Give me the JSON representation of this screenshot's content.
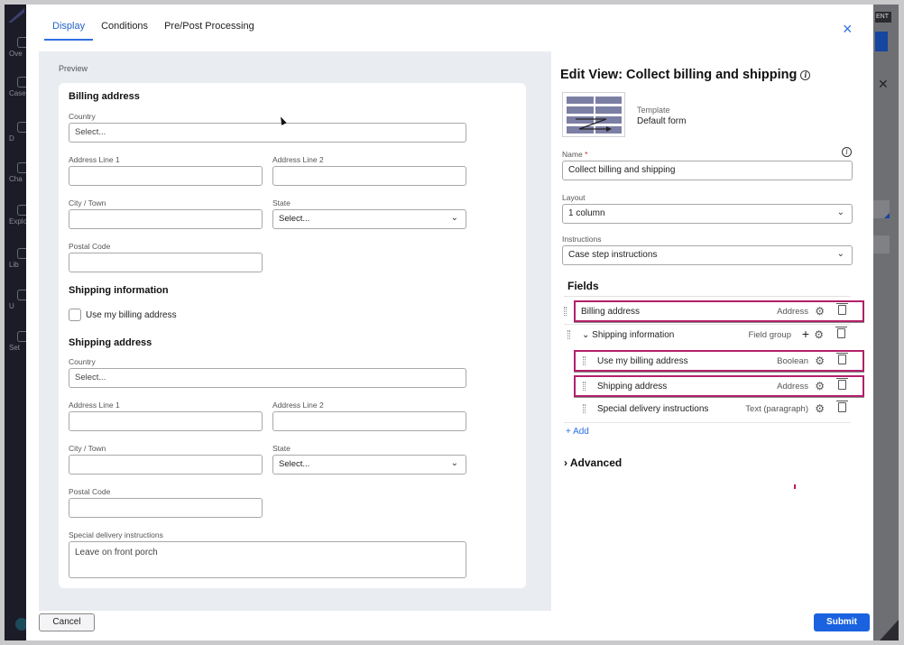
{
  "background_app": {
    "nav_items": [
      "Ove",
      "Case",
      "D",
      "Cha",
      "Explo",
      "Lib",
      "U",
      "Set"
    ],
    "env_badge": "ENT"
  },
  "modal": {
    "tabs": [
      {
        "label": "Display",
        "active": true
      },
      {
        "label": "Conditions",
        "active": false
      },
      {
        "label": "Pre/Post Processing",
        "active": false
      }
    ],
    "close_label": "×",
    "preview": {
      "label": "Preview",
      "billing": {
        "title": "Billing address",
        "country_label": "Country",
        "country_placeholder": "Select...",
        "addr1_label": "Address Line 1",
        "addr2_label": "Address Line 2",
        "city_label": "City / Town",
        "state_label": "State",
        "state_placeholder": "Select...",
        "postal_label": "Postal Code"
      },
      "shipping_info": {
        "title": "Shipping information",
        "checkbox_label": "Use my billing address",
        "checked": false
      },
      "shipping": {
        "title": "Shipping address",
        "country_label": "Country",
        "country_placeholder": "Select...",
        "addr1_label": "Address Line 1",
        "addr2_label": "Address Line 2",
        "city_label": "City / Town",
        "state_label": "State",
        "state_placeholder": "Select...",
        "postal_label": "Postal Code"
      },
      "special": {
        "label": "Special delivery instructions",
        "value": "Leave on front porch"
      }
    },
    "edit_view": {
      "title": "Edit View: Collect billing and shipping",
      "template_label": "Template",
      "template_value": "Default form",
      "name_label": "Name",
      "name_required": "*",
      "name_value": "Collect billing and shipping",
      "layout_label": "Layout",
      "layout_value": "1 column",
      "instructions_label": "Instructions",
      "instructions_value": "Case step instructions",
      "fields_title": "Fields",
      "fields": [
        {
          "name": "Billing address",
          "type": "Address",
          "highlighted": true
        },
        {
          "name": "Shipping information",
          "type": "Field group",
          "highlighted": false,
          "group": true
        },
        {
          "name": "Use my billing address",
          "type": "Boolean",
          "highlighted": true
        },
        {
          "name": "Shipping address",
          "type": "Address",
          "highlighted": true
        },
        {
          "name": "Special delivery instructions",
          "type": "Text (paragraph)",
          "highlighted": false
        }
      ],
      "add_label": "+ Add",
      "advanced_label": "› Advanced"
    },
    "footer": {
      "cancel_label": "Cancel",
      "submit_label": "Submit"
    }
  },
  "colors": {
    "accent": "#1a62e0",
    "highlight": "#b3206a"
  }
}
